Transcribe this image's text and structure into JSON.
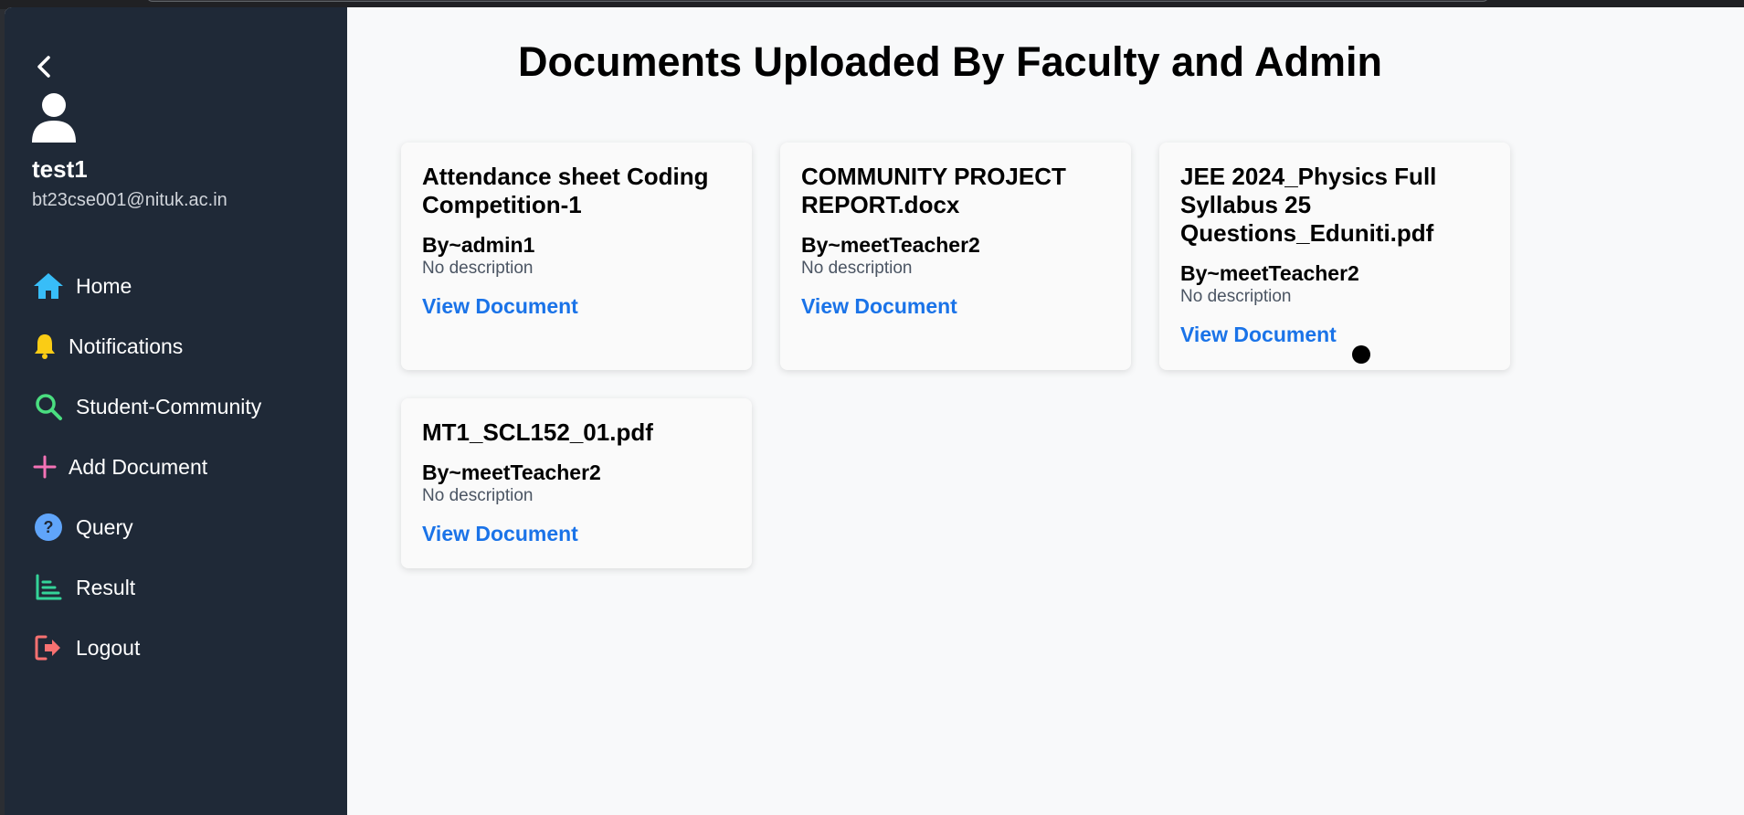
{
  "colors": {
    "sidebar_bg": "#1f2937",
    "link": "#1a73e8",
    "home_icon": "#38bdf8",
    "bell_icon": "#facc15",
    "search_icon": "#4ade80",
    "add_icon": "#f472b6",
    "query_icon": "#60a5fa",
    "result_icon": "#34d399",
    "logout_icon": "#f87171"
  },
  "user": {
    "name": "test1",
    "email": "bt23cse001@nituk.ac.in"
  },
  "sidebar": {
    "items": [
      {
        "label": "Home",
        "icon": "home-icon"
      },
      {
        "label": "Notifications",
        "icon": "bell-icon"
      },
      {
        "label": "Student-Community",
        "icon": "search-icon"
      },
      {
        "label": "Add Document",
        "icon": "plus-icon"
      },
      {
        "label": "Query",
        "icon": "question-icon"
      },
      {
        "label": "Result",
        "icon": "bar-chart-icon"
      },
      {
        "label": "Logout",
        "icon": "logout-icon"
      }
    ]
  },
  "main": {
    "title": "Documents Uploaded By Faculty and Admin",
    "documents": [
      {
        "title": "Attendance sheet Coding Competition-1",
        "author": "By~admin1",
        "description": "No description",
        "link": "View Document"
      },
      {
        "title": "COMMUNITY PROJECT REPORT.docx",
        "author": "By~meetTeacher2",
        "description": "No description",
        "link": "View Document"
      },
      {
        "title": "JEE 2024_Physics Full Syllabus 25 Questions_Eduniti.pdf",
        "author": "By~meetTeacher2",
        "description": "No description",
        "link": "View Document"
      },
      {
        "title": "MT1_SCL152_01.pdf",
        "author": "By~meetTeacher2",
        "description": "No description",
        "link": "View Document"
      }
    ]
  }
}
